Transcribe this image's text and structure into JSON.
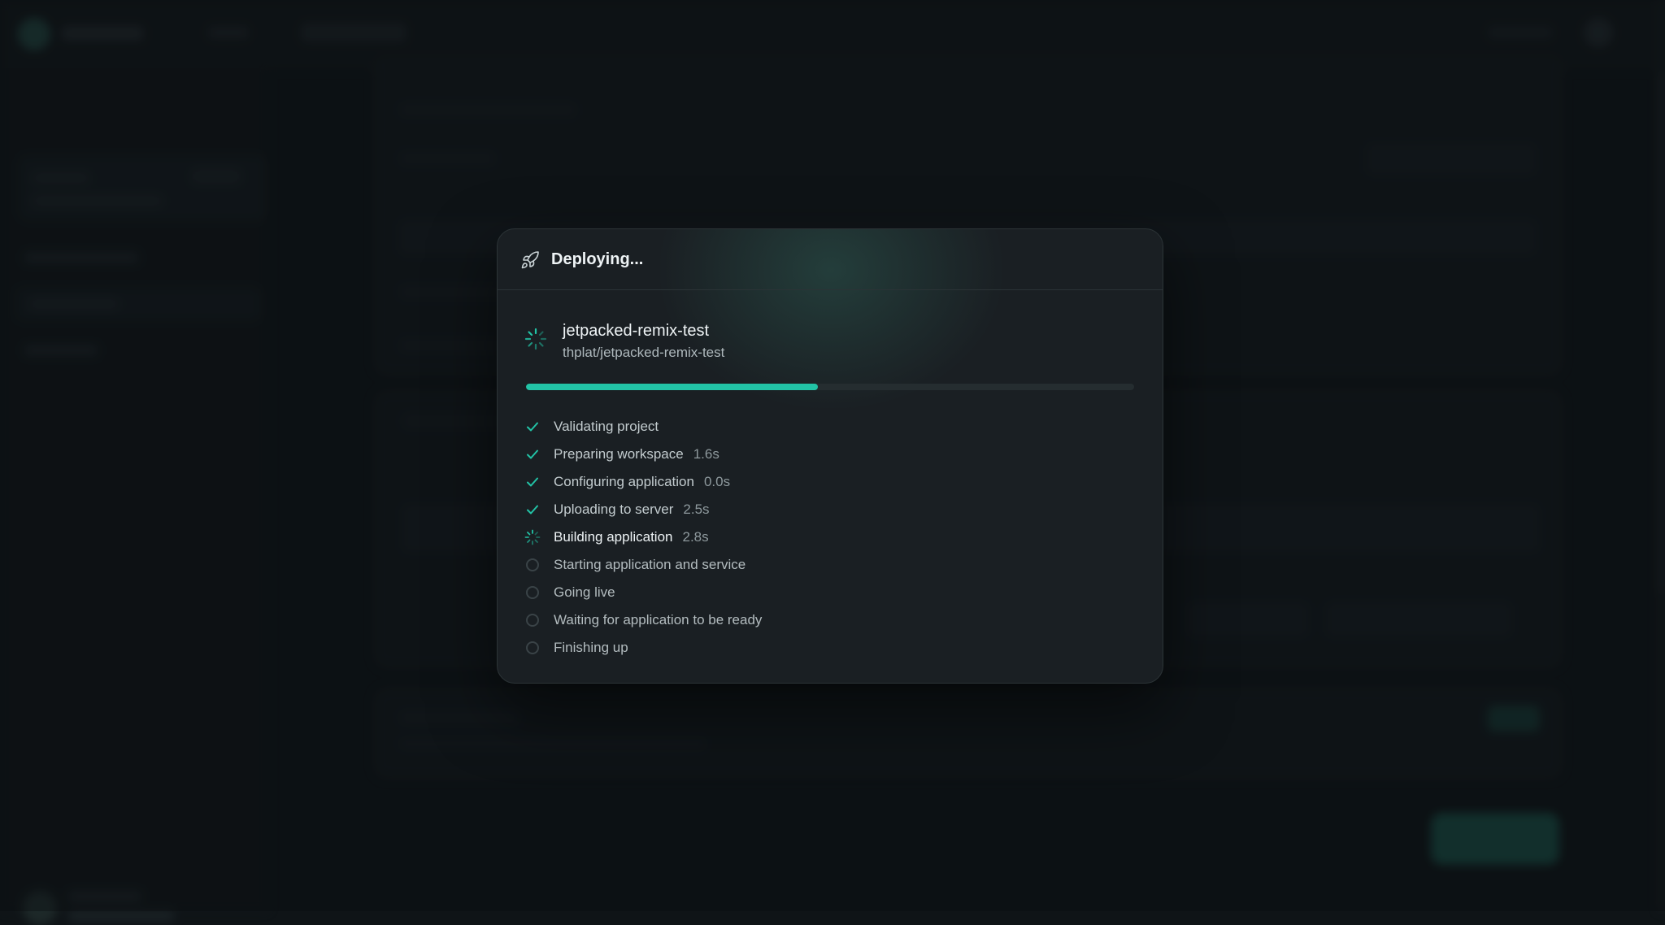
{
  "modal": {
    "title": "Deploying...",
    "icon": "rocket-icon"
  },
  "project": {
    "name": "jetpacked-remix-test",
    "repo": "thplat/jetpacked-remix-test"
  },
  "progress": {
    "fraction": 0.48
  },
  "colors": {
    "accent": "#22c3a6",
    "modal_bg": "#1a1f23",
    "page_bg": "#0f1417"
  },
  "steps": [
    {
      "label": "Validating project",
      "time": "",
      "status": "done"
    },
    {
      "label": "Preparing workspace",
      "time": "1.6s",
      "status": "done"
    },
    {
      "label": "Configuring application",
      "time": "0.0s",
      "status": "done"
    },
    {
      "label": "Uploading to server",
      "time": "2.5s",
      "status": "done"
    },
    {
      "label": "Building application",
      "time": "2.8s",
      "status": "active"
    },
    {
      "label": "Starting application and service",
      "time": "",
      "status": "pending"
    },
    {
      "label": "Going live",
      "time": "",
      "status": "pending"
    },
    {
      "label": "Waiting for application to be ready",
      "time": "",
      "status": "pending"
    },
    {
      "label": "Finishing up",
      "time": "",
      "status": "pending"
    }
  ]
}
